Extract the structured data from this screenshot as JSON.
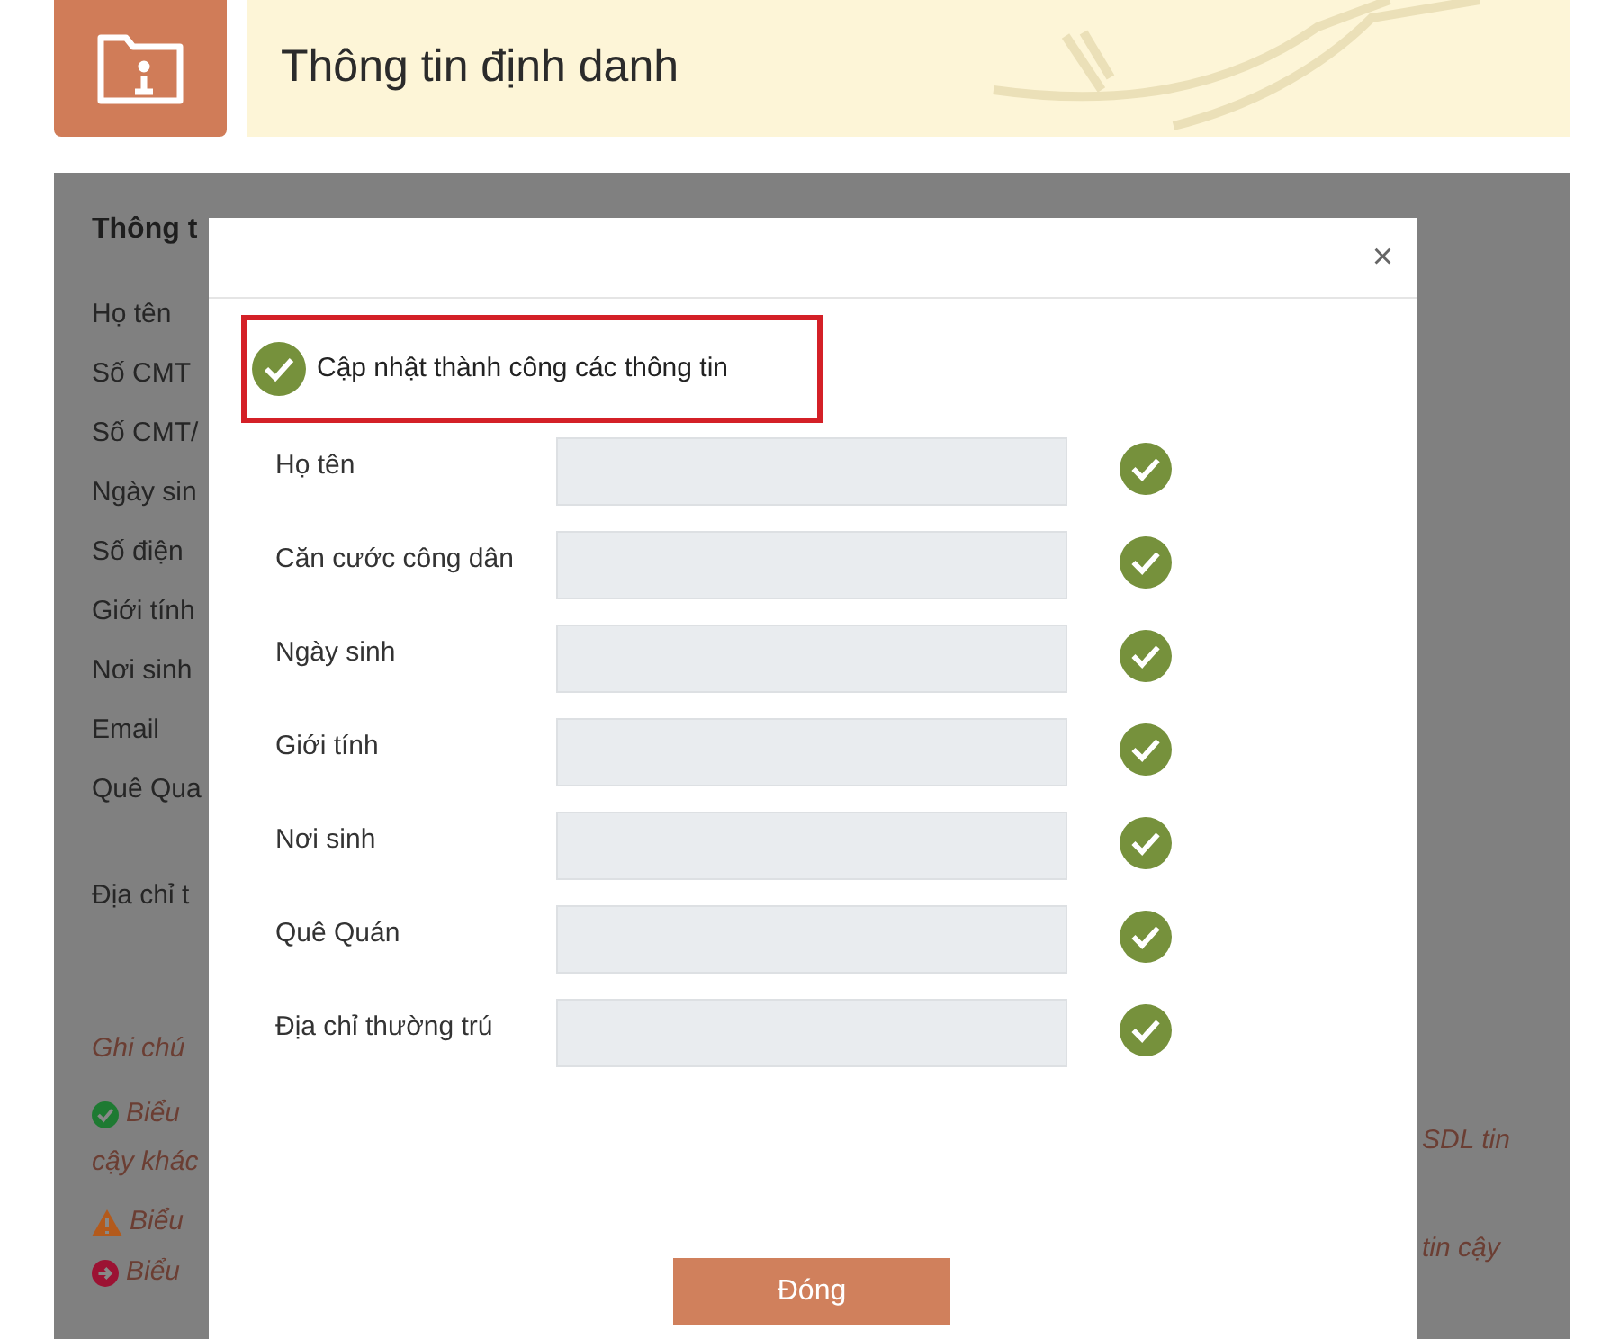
{
  "header": {
    "title": "Thông tin định danh"
  },
  "background_panel": {
    "heading": "Thông t",
    "labels": [
      "Họ tên",
      "Số CMT",
      "Số CMT/",
      "Ngày sin",
      "Số điện",
      "Giới tính",
      "Nơi sinh",
      "Email",
      "Quê Qua",
      "Địa chỉ t"
    ],
    "note_title": "Ghi chú",
    "notes": [
      {
        "kind": "success",
        "text": "Biểu",
        "continuation": "cậy khác",
        "right_text": "SDL tin"
      },
      {
        "kind": "warning",
        "text": "Biểu",
        "right_text": "tin cậy"
      },
      {
        "kind": "error",
        "text": "Biểu"
      }
    ]
  },
  "modal": {
    "close": "×",
    "message": "Cập nhật thành công các thông tin",
    "fields": [
      {
        "label": "Họ tên",
        "verified": true
      },
      {
        "label": "Căn cước công dân",
        "verified": true
      },
      {
        "label": "Ngày sinh",
        "verified": true
      },
      {
        "label": "Giới tính",
        "verified": true
      },
      {
        "label": "Nơi sinh",
        "verified": true
      },
      {
        "label": "Quê Quán",
        "verified": true
      },
      {
        "label": "Địa chỉ thường trú",
        "verified": true
      }
    ],
    "button": "Đóng"
  }
}
